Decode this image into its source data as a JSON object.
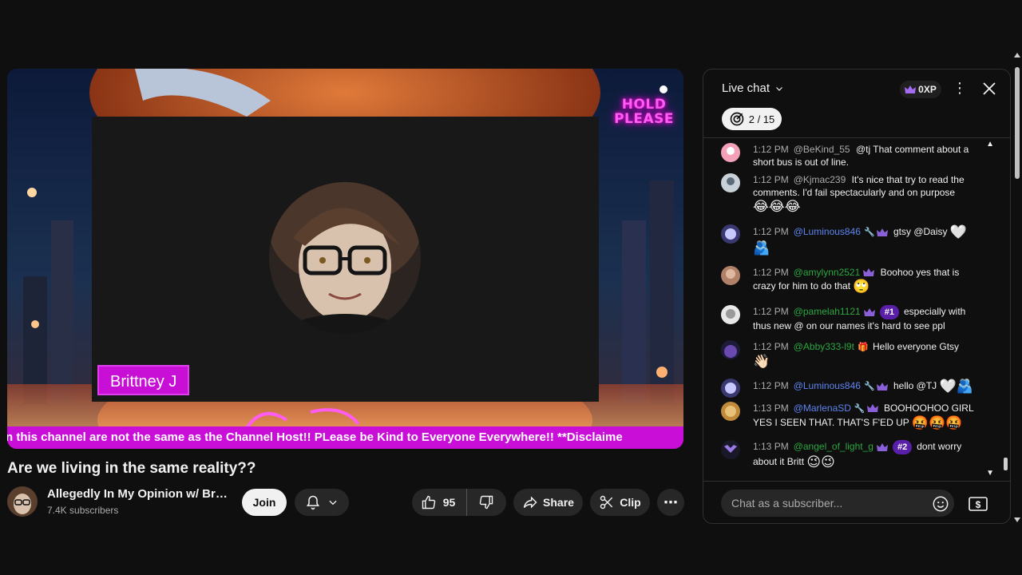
{
  "video": {
    "hold_line1": "HOLD",
    "hold_line2": "PLEASE",
    "name_tag": "Brittney J",
    "ticker": "n this channel are not the same as the Channel Host!! PLease be Kind to Everyone Everywhere!! **Disclaime"
  },
  "meta": {
    "title": "Are we living in the same reality??",
    "channel_name": "Allegedly In My Opinion w/ Brit…",
    "subscribers": "7.4K subscribers"
  },
  "actions": {
    "join": "Join",
    "likes": "95",
    "share": "Share",
    "clip": "Clip"
  },
  "chat": {
    "title": "Live chat",
    "xp": "0XP",
    "progress": "2 / 15",
    "input_placeholder": "Chat as a subscriber...",
    "messages": [
      {
        "time": "1:12 PM",
        "author": "@BeKind_55",
        "text": "@tj That comment about a short bus is out of line."
      },
      {
        "time": "1:12 PM",
        "author": "@Kjmac239",
        "text": "It's nice that try to read the comments. I'd fail spectacularly and on purpose",
        "emojis": "😂😂😂"
      },
      {
        "time": "1:12 PM",
        "author": "@Luminous846",
        "text": "gtsy @Daisy",
        "emojis_inline": "🤍",
        "emojis": "🫂"
      },
      {
        "time": "1:12 PM",
        "author": "@amylynn2521",
        "text": "Boohoo yes that is crazy for him to do that",
        "emojis_inline": "🙄"
      },
      {
        "time": "1:12 PM",
        "author": "@pamelah1121",
        "rank": "#1",
        "text": "especially with thus new @ on our names it's hard to see ppl"
      },
      {
        "time": "1:12 PM",
        "author": "@Abby333-l9t",
        "text": "Hello everyone Gtsy",
        "emojis": "👋🏻"
      },
      {
        "time": "1:12 PM",
        "author": "@Luminous846",
        "text": "hello @TJ",
        "emojis_inline": "🤍🫂"
      },
      {
        "time": "1:13 PM",
        "author": "@MarlenaSD",
        "text": "BOOHOOHOO GIRL YES I SEEN THAT. THAT'S F'ED UP",
        "emojis_inline": "🤬🤬🤬"
      },
      {
        "time": "1:13 PM",
        "author": "@angel_of_light_g",
        "rank": "#2",
        "text": "dont worry about it Britt",
        "emojis_inline": "😉😉"
      }
    ]
  },
  "colors": {
    "accent_magenta": "#c90ed8",
    "member_green": "#2ba640",
    "mod_blue": "#5e84f1",
    "rank_purple": "#5a1fa8"
  },
  "icons": [
    "bell-icon",
    "chevron-down-icon",
    "thumbs-up-icon",
    "thumbs-down-icon",
    "share-icon",
    "scissors-icon",
    "more-icon",
    "crown-icon",
    "close-icon",
    "target-icon",
    "smiley-icon",
    "money-icon"
  ]
}
